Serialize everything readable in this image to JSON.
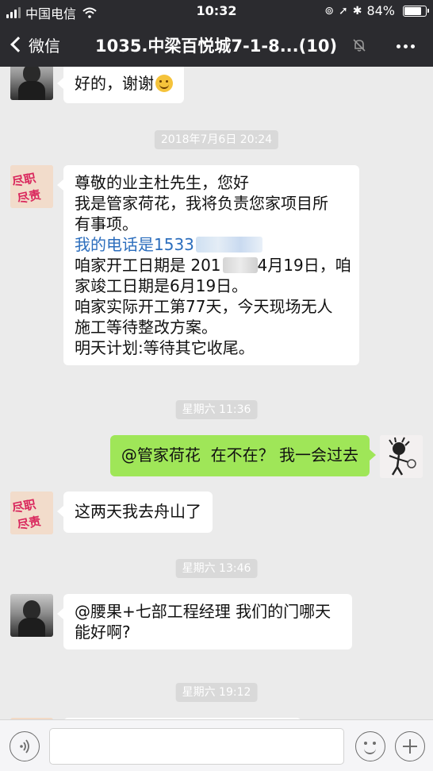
{
  "status_bar": {
    "carrier": "中国电信",
    "time": "10:32",
    "battery": "84%",
    "battery_level": 0.84
  },
  "nav": {
    "back_label": "微信",
    "title": "1035.中梁百悦城7-1-8...(10)"
  },
  "messages": [
    {
      "side": "left",
      "avatar": "person-avatar",
      "lines": [
        "好的，谢谢"
      ],
      "emoji": "smile-emoji"
    },
    {
      "type": "time",
      "text": "2018年7月6日 20:24"
    },
    {
      "side": "left",
      "avatar": "logo-avatar",
      "lines": [
        "尊敬的业主杜先生，您好",
        "我是管家荷花，我将负责您家项目所",
        "有事项。",
        "我的电话是1533",
        "咱家开工日期是 201",
        "4月19日，咱",
        "家竣工日期是6月19日。",
        "咱家实际开工第77天，今天现场无人",
        "施工等待整改方案。",
        "明天计划:等待其它收尾。"
      ]
    },
    {
      "type": "time",
      "text": "星期六 11:36"
    },
    {
      "side": "right",
      "avatar": "cartoon-avatar",
      "lines": [
        "@管家荷花  在不在？ 我一会过去"
      ]
    },
    {
      "side": "left",
      "avatar": "logo-avatar",
      "lines": [
        "这两天我去舟山了"
      ]
    },
    {
      "type": "time",
      "text": "星期六 13:46"
    },
    {
      "side": "left",
      "avatar": "person-avatar",
      "lines": [
        "@腰果+七部工程经理 我们的门哪天",
        "能好啊?"
      ]
    },
    {
      "type": "time",
      "text": "星期六 19:12"
    }
  ],
  "input": {
    "placeholder": ""
  },
  "colors": {
    "header_bg": "#2b2b2f",
    "chat_bg": "#ebebeb",
    "sent_bubble": "#9fe658",
    "received_bubble": "#ffffff",
    "link": "#2c6ebd"
  }
}
